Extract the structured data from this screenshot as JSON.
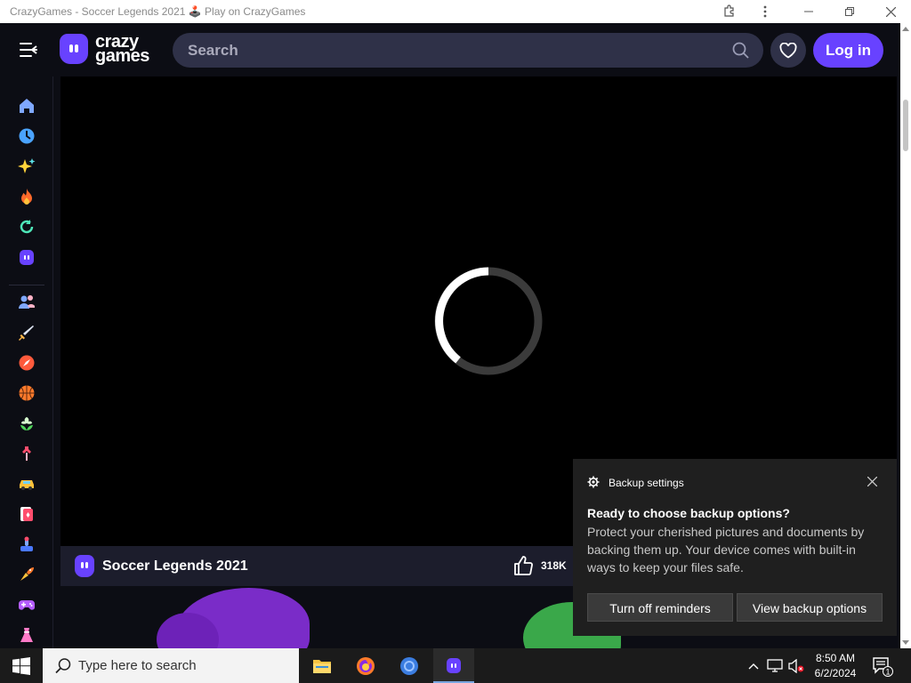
{
  "window": {
    "title": "CrazyGames - Soccer Legends 2021 🕹️ Play on CrazyGames"
  },
  "header": {
    "logo_line1": "crazy",
    "logo_line2": "games",
    "search_placeholder": "Search",
    "login_label": "Log in",
    "brand_color": "#6842ff"
  },
  "sidebar": {
    "items": [
      {
        "icon": "home-icon"
      },
      {
        "icon": "recent-icon"
      },
      {
        "icon": "new-sparkle-icon"
      },
      {
        "icon": "trending-fire-icon"
      },
      {
        "icon": "updated-icon"
      },
      {
        "icon": "originals-icon"
      },
      {
        "icon": "multiplayer-icon"
      },
      {
        "icon": "action-sword-icon"
      },
      {
        "icon": "adventure-compass-icon"
      },
      {
        "icon": "basketball-icon"
      },
      {
        "icon": "casual-flower-icon"
      },
      {
        "icon": "clicker-icon"
      },
      {
        "icon": "driving-car-icon"
      },
      {
        "icon": "card-icon"
      },
      {
        "icon": "controller-icon"
      },
      {
        "icon": "io-icon"
      },
      {
        "icon": "gamepad-icon"
      },
      {
        "icon": "dress-up-icon"
      }
    ]
  },
  "game": {
    "title": "Soccer Legends 2021",
    "likes": "318K"
  },
  "toast": {
    "app": "Backup settings",
    "heading": "Ready to choose backup options?",
    "body": "Protect your cherished pictures and documents by backing them up. Your device comes with built-in ways to keep your files safe.",
    "button_dismiss": "Turn off reminders",
    "button_action": "View backup options"
  },
  "taskbar": {
    "search_placeholder": "Type here to search",
    "time": "8:50 AM",
    "date": "6/2/2024",
    "notification_count": "1"
  }
}
